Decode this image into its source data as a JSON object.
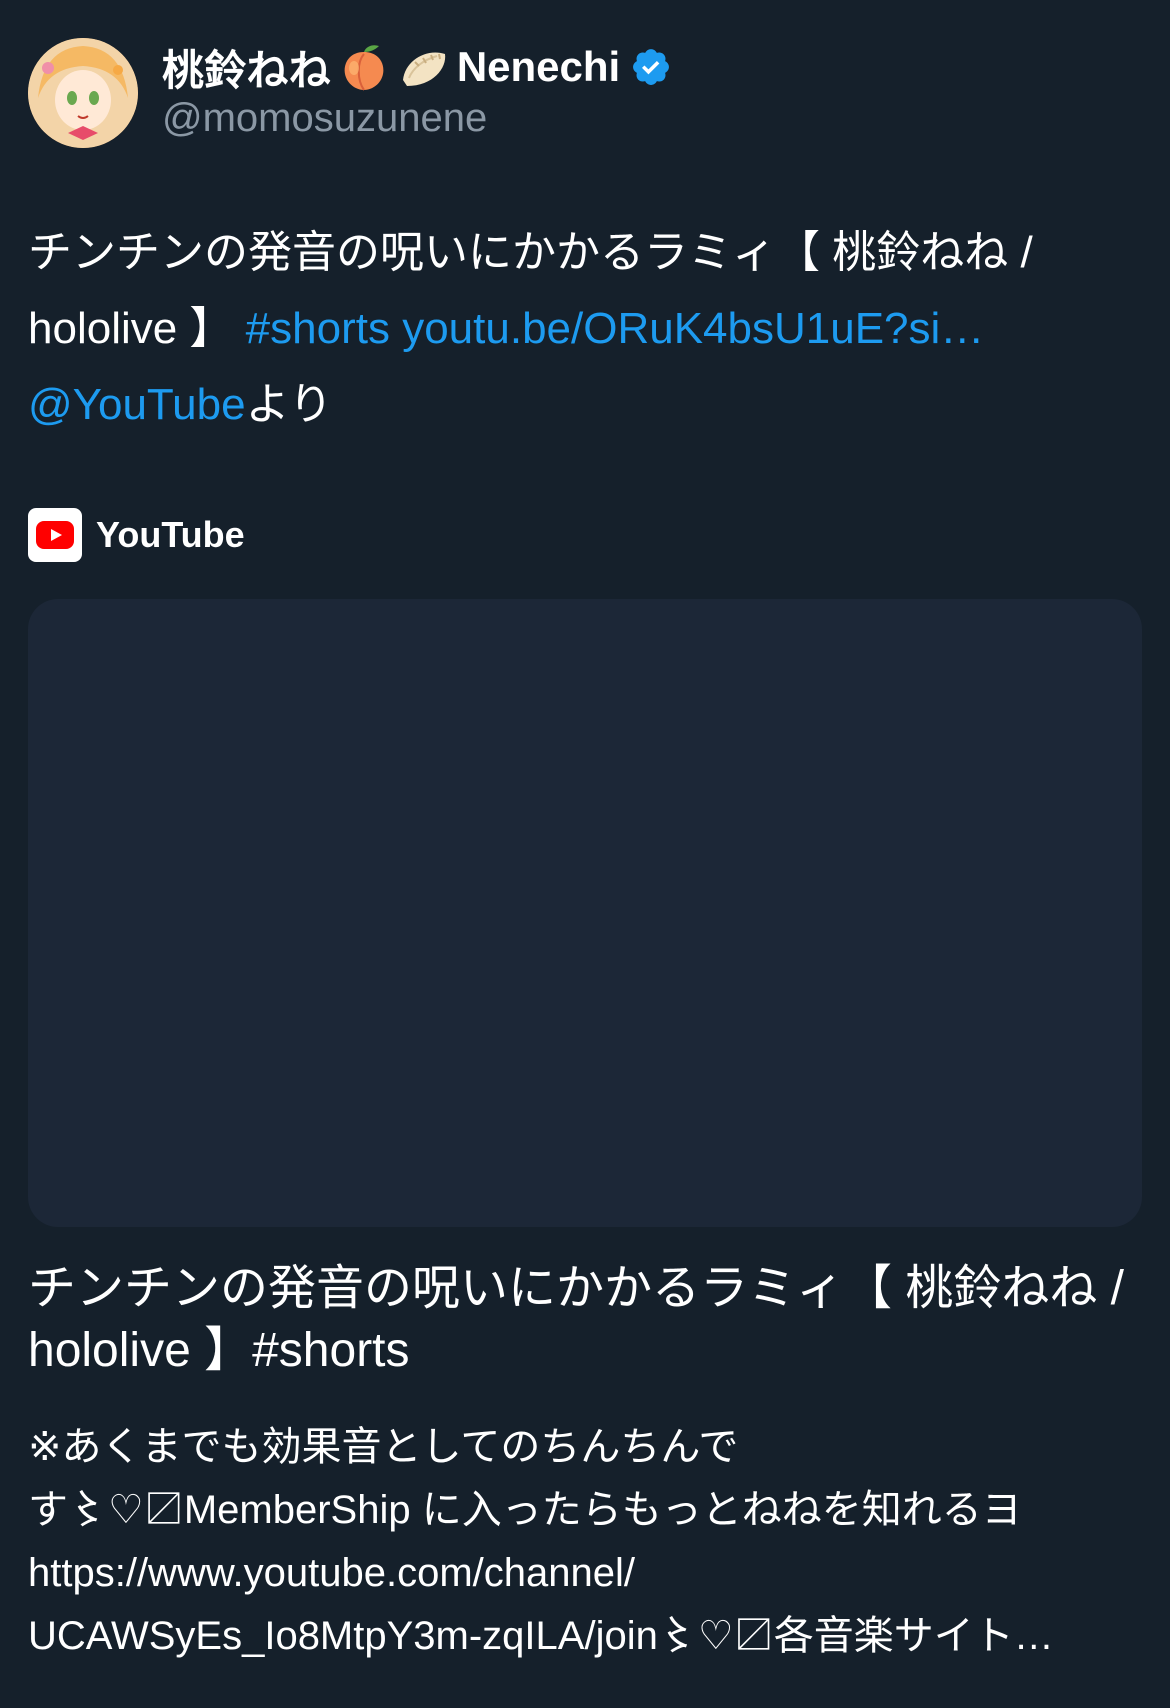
{
  "author": {
    "display_name": "桃鈴ねね",
    "emoji_1": "peach",
    "emoji_2": "dumpling",
    "display_name_suffix": "Nenechi",
    "handle": "@momosuzunene",
    "verified": true
  },
  "tweet": {
    "text_1": "チンチンの発音の呪いにかかるラミィ【 桃鈴ねね / hololive 】",
    "hashtag": "#shorts",
    "url": "youtu.be/ORuK4bsU1uE?si…",
    "mention": "@YouTube",
    "suffix": "より"
  },
  "source": {
    "icon": "youtube-logo",
    "label": "YouTube"
  },
  "card": {
    "title": "チンチンの発音の呪いにかかるラミィ【 桃鈴ねね / hololive 】#shorts",
    "description_lines": [
      "※あくまでも効果音としてのちんちんで",
      "す〻♡〼MemberShip に入ったらもっとねねを知れるヨ",
      "https://www.youtube.com/channel/",
      "UCAWSyEs_Io8MtpY3m-zqILA/join〻♡〼各音楽サイト…"
    ]
  },
  "colors": {
    "background": "#15202b",
    "link": "#1d9bf0",
    "secondary_text": "#8b98a5",
    "card_bg": "#1c2737",
    "youtube_red": "#ff0000"
  }
}
